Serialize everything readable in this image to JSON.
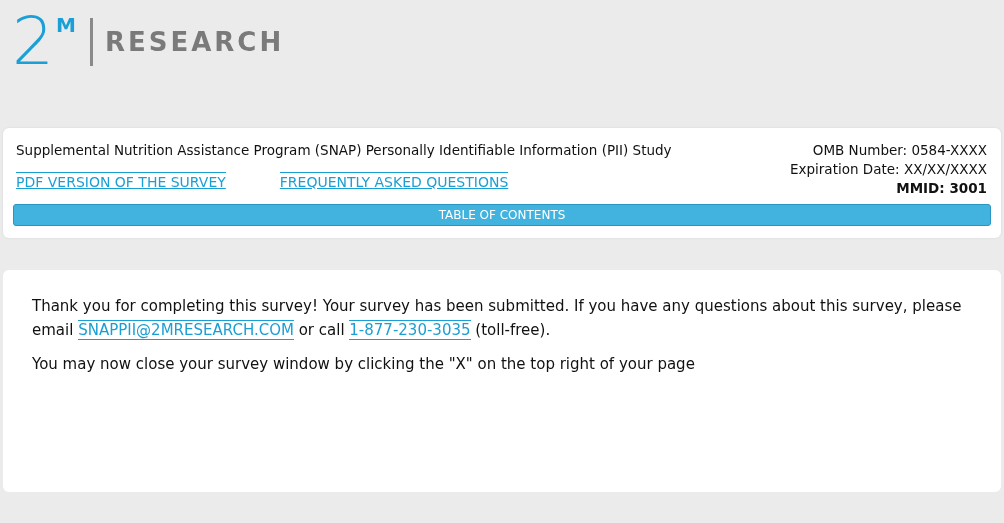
{
  "logo": {
    "numeral": "2",
    "superscript": "M",
    "name": "RESEARCH"
  },
  "header": {
    "study_title": "Supplemental Nutrition Assistance Program (SNAP) Personally Identifiable Information (PII) Study",
    "links": [
      "PDF VERSION OF THE SURVEY",
      "FREQUENTLY ASKED QUESTIONS"
    ],
    "omb_number": "OMB Number: 0584-XXXX",
    "expiration": "Expiration Date: XX/XX/XXXX",
    "mmid": "MMID: 3001",
    "toc_button": "TABLE OF CONTENTS"
  },
  "message": {
    "text_before": "Thank you for completing this survey! Your survey has been submitted. If you have any questions about this survey, please email ",
    "email": "SNAPPII@2MRESEARCH.COM",
    "text_middle": " or call ",
    "phone": "1-877-230-3035",
    "text_after": " (toll-free).",
    "closing": "You may now close your survey window by clicking the \"X\" on the top right of your page"
  }
}
